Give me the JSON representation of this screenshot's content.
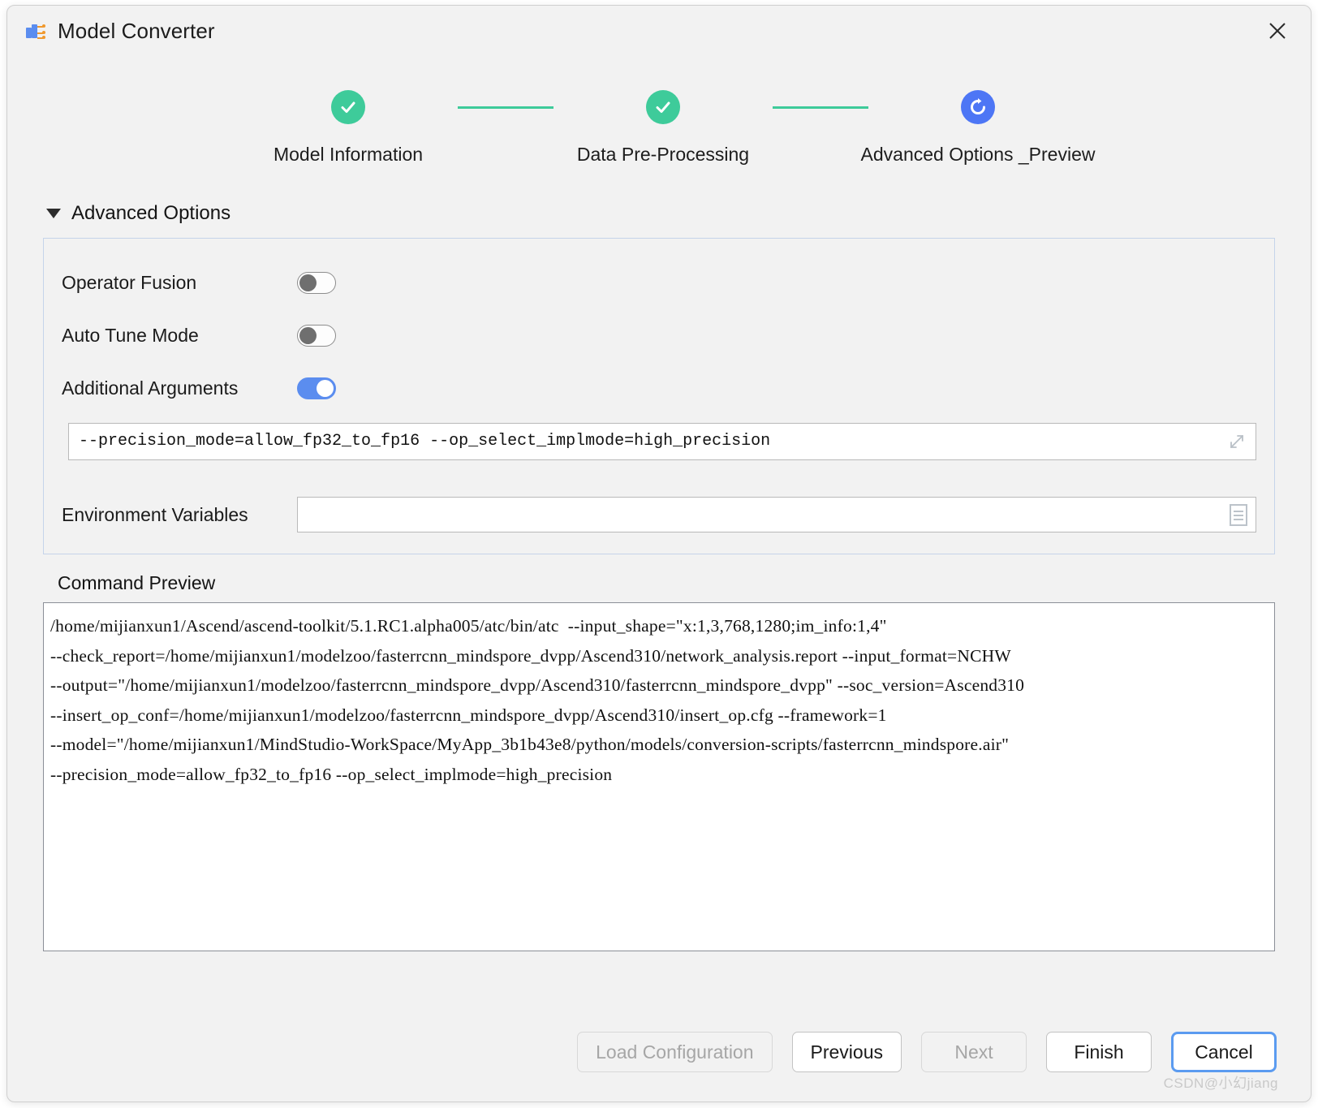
{
  "window": {
    "title": "Model Converter",
    "icon": "model-converter-icon",
    "close_label": "✕"
  },
  "stepper": {
    "steps": [
      {
        "label": "Model Information",
        "state": "done",
        "icon": "check-icon"
      },
      {
        "label": "Data Pre-Processing",
        "state": "done",
        "icon": "check-icon"
      },
      {
        "label": "Advanced Options _Preview",
        "state": "active",
        "icon": "refresh-icon"
      }
    ],
    "colors": {
      "done": "#3ecb9a",
      "active": "#4d76f5",
      "connector": "#3ecb9a"
    }
  },
  "advanced_options": {
    "section_title": "Advanced Options",
    "expanded": true,
    "toggles": [
      {
        "label": "Operator Fusion",
        "state": "off"
      },
      {
        "label": "Auto Tune Mode",
        "state": "off"
      },
      {
        "label": "Additional Arguments",
        "state": "on"
      }
    ],
    "additional_arguments": {
      "value": "--precision_mode=allow_fp32_to_fp16 --op_select_implmode=high_precision",
      "placeholder": "",
      "expand_icon": "expand-arrows-icon"
    },
    "environment_variables": {
      "label": "Environment Variables",
      "value": "",
      "placeholder": "",
      "list_icon": "list-editor-icon"
    },
    "accent_border": "#c5d4ea"
  },
  "command_preview": {
    "label": "Command Preview",
    "lines": [
      "/home/mijianxun1/Ascend/ascend-toolkit/5.1.RC1.alpha005/atc/bin/atc  --input_shape=\"x:1,3,768,1280;im_info:1,4\"",
      "--check_report=/home/mijianxun1/modelzoo/fasterrcnn_mindspore_dvpp/Ascend310/network_analysis.report --input_format=NCHW",
      "--output=\"/home/mijianxun1/modelzoo/fasterrcnn_mindspore_dvpp/Ascend310/fasterrcnn_mindspore_dvpp\" --soc_version=Ascend310",
      "--insert_op_conf=/home/mijianxun1/modelzoo/fasterrcnn_mindspore_dvpp/Ascend310/insert_op.cfg --framework=1",
      "--model=\"/home/mijianxun1/MindStudio-WorkSpace/MyApp_3b1b43e8/python/models/conversion-scripts/fasterrcnn_mindspore.air\"",
      "--precision_mode=allow_fp32_to_fp16 --op_select_implmode=high_precision"
    ]
  },
  "footer": {
    "buttons": [
      {
        "label": "Load Configuration",
        "state": "disabled"
      },
      {
        "label": "Previous",
        "state": "enabled"
      },
      {
        "label": "Next",
        "state": "disabled"
      },
      {
        "label": "Finish",
        "state": "enabled"
      },
      {
        "label": "Cancel",
        "state": "focused"
      }
    ]
  },
  "watermark": "CSDN@小幻jiang"
}
